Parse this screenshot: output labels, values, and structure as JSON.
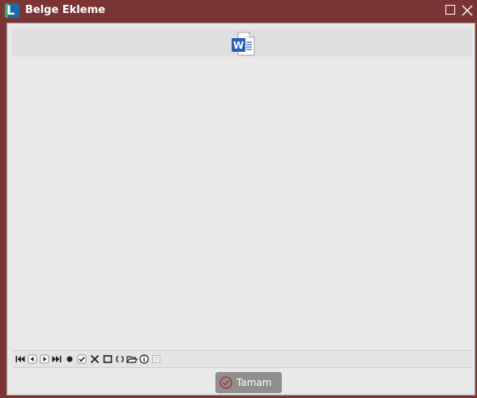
{
  "window": {
    "title": "Belge Ekleme",
    "logo_letter": "L",
    "frame_color": "#7b3434"
  },
  "title_buttons": {
    "maximize_icon": "maximize-icon",
    "close_icon": "close-icon"
  },
  "document": {
    "file_icon": "word-document-icon",
    "file_icon_letter": "W",
    "accent_color": "#2b5fb7"
  },
  "nav_toolbar": {
    "buttons": [
      {
        "name": "first-record",
        "icon": "skip-first-icon"
      },
      {
        "name": "prior-record",
        "icon": "prior-icon"
      },
      {
        "name": "next-record",
        "icon": "next-icon"
      },
      {
        "name": "last-record",
        "icon": "skip-last-icon"
      },
      {
        "name": "insert-record",
        "icon": "dot-icon"
      },
      {
        "name": "post-record",
        "icon": "check-icon"
      },
      {
        "name": "delete-record",
        "icon": "x-icon"
      },
      {
        "name": "cancel-record",
        "icon": "square-icon"
      },
      {
        "name": "refresh-record",
        "icon": "refresh-icon"
      },
      {
        "name": "open-file",
        "icon": "folder-open-icon"
      },
      {
        "name": "info",
        "icon": "info-icon"
      },
      {
        "name": "extra",
        "icon": "disabled-square-icon"
      }
    ]
  },
  "footer": {
    "ok_label": "Tamam",
    "ok_icon": "check-circle-icon",
    "ok_color": "#8f8f8f"
  }
}
